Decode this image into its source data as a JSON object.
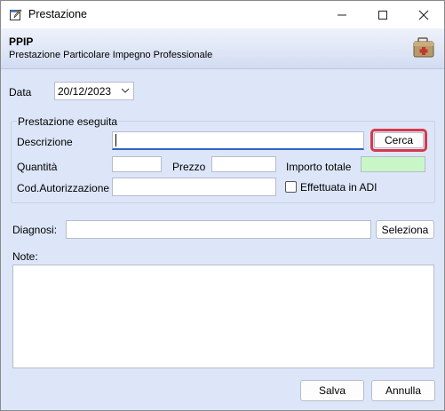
{
  "window": {
    "title": "Prestazione"
  },
  "header": {
    "title": "PPIP",
    "subtitle": "Prestazione Particolare Impegno Professionale"
  },
  "form": {
    "date_label": "Data",
    "date_value": "20/12/2023",
    "group_title": "Prestazione eseguita",
    "description_label": "Descrizione",
    "description_value": "",
    "search_button": "Cerca",
    "quantity_label": "Quantità",
    "quantity_value": "",
    "price_label": "Prezzo",
    "price_value": "",
    "total_label": "Importo totale",
    "total_value": "",
    "authorization_label": "Cod.Autorizzazione",
    "authorization_value": "",
    "adi_label": "Effettuata in ADI",
    "adi_checked": false,
    "diagnosis_label": "Diagnosi:",
    "diagnosis_value": "",
    "select_button": "Seleziona",
    "notes_label": "Note:",
    "notes_value": ""
  },
  "footer": {
    "save_button": "Salva",
    "cancel_button": "Annulla"
  },
  "icons": {
    "app": "edit-window-icon",
    "header": "medical-kit-icon",
    "date_dropdown": "chevron-down-icon"
  },
  "colors": {
    "background": "#dde6f8",
    "highlight_border": "#d63a4a",
    "total_field": "#c9f6c6"
  }
}
